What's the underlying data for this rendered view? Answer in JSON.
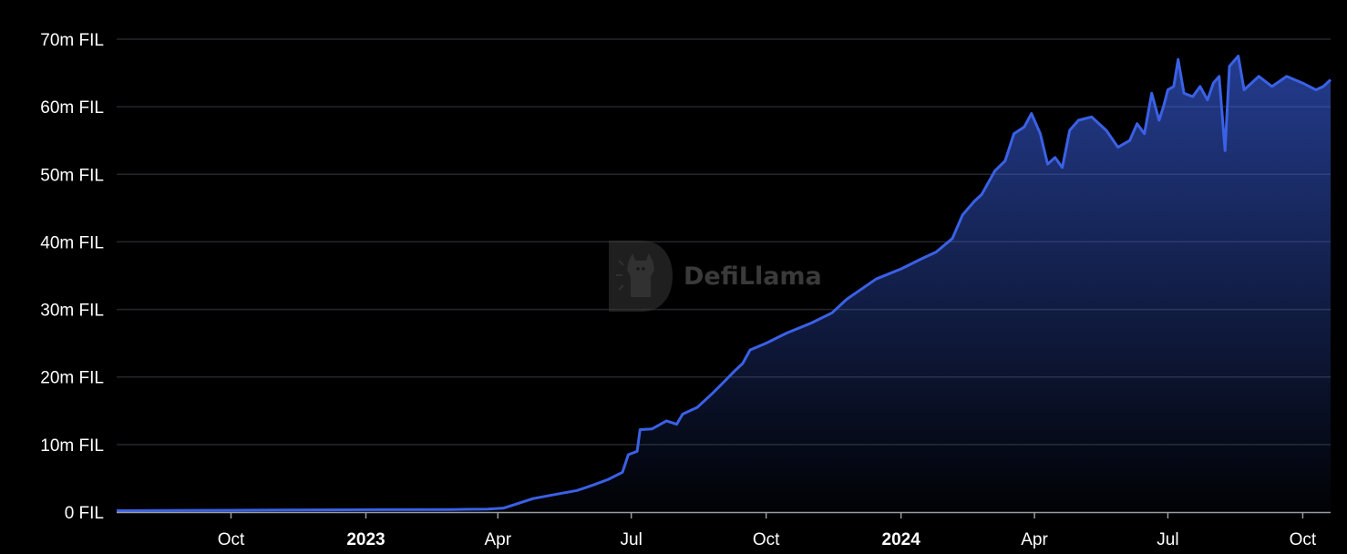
{
  "chart_data": {
    "type": "area",
    "title": "",
    "xlabel": "",
    "ylabel": "",
    "unit": "FIL",
    "ylim": [
      0,
      70000000
    ],
    "xlim": [
      "2022-07-15",
      "2024-10-20"
    ],
    "grid": true,
    "legend": "none",
    "y_ticks": [
      {
        "value": 0,
        "label": "0 FIL"
      },
      {
        "value": 10000000,
        "label": "10m FIL"
      },
      {
        "value": 20000000,
        "label": "20m FIL"
      },
      {
        "value": 30000000,
        "label": "30m FIL"
      },
      {
        "value": 40000000,
        "label": "40m FIL"
      },
      {
        "value": 50000000,
        "label": "50m FIL"
      },
      {
        "value": 60000000,
        "label": "60m FIL"
      },
      {
        "value": 70000000,
        "label": "70m FIL"
      }
    ],
    "x_ticks": [
      {
        "date": "2022-10-01",
        "label": "Oct",
        "bold": false
      },
      {
        "date": "2023-01-01",
        "label": "2023",
        "bold": true
      },
      {
        "date": "2023-04-01",
        "label": "Apr",
        "bold": false
      },
      {
        "date": "2023-07-01",
        "label": "Jul",
        "bold": false
      },
      {
        "date": "2023-10-01",
        "label": "Oct",
        "bold": false
      },
      {
        "date": "2024-01-01",
        "label": "2024",
        "bold": true
      },
      {
        "date": "2024-04-01",
        "label": "Apr",
        "bold": false
      },
      {
        "date": "2024-07-01",
        "label": "Jul",
        "bold": false
      },
      {
        "date": "2024-10-01",
        "label": "Oct",
        "bold": false
      }
    ],
    "series": [
      {
        "color": "#3a61e6",
        "points": [
          [
            "2022-07-15",
            200000
          ],
          [
            "2022-09-01",
            250000
          ],
          [
            "2022-11-01",
            300000
          ],
          [
            "2023-01-01",
            350000
          ],
          [
            "2023-03-01",
            380000
          ],
          [
            "2023-03-25",
            450000
          ],
          [
            "2023-04-05",
            600000
          ],
          [
            "2023-04-15",
            1300000
          ],
          [
            "2023-04-25",
            2000000
          ],
          [
            "2023-05-10",
            2600000
          ],
          [
            "2023-05-25",
            3200000
          ],
          [
            "2023-06-05",
            4000000
          ],
          [
            "2023-06-15",
            4800000
          ],
          [
            "2023-06-25",
            5900000
          ],
          [
            "2023-06-29",
            8500000
          ],
          [
            "2023-07-05",
            9000000
          ],
          [
            "2023-07-07",
            12200000
          ],
          [
            "2023-07-15",
            12300000
          ],
          [
            "2023-07-25",
            13500000
          ],
          [
            "2023-08-01",
            13000000
          ],
          [
            "2023-08-05",
            14500000
          ],
          [
            "2023-08-15",
            15500000
          ],
          [
            "2023-08-25",
            17500000
          ],
          [
            "2023-09-01",
            19000000
          ],
          [
            "2023-09-10",
            21000000
          ],
          [
            "2023-09-15",
            22000000
          ],
          [
            "2023-09-20",
            24000000
          ],
          [
            "2023-10-01",
            25000000
          ],
          [
            "2023-10-15",
            26500000
          ],
          [
            "2023-11-01",
            28000000
          ],
          [
            "2023-11-15",
            29500000
          ],
          [
            "2023-11-25",
            31500000
          ],
          [
            "2023-12-05",
            33000000
          ],
          [
            "2023-12-15",
            34500000
          ],
          [
            "2024-01-01",
            36000000
          ],
          [
            "2024-01-15",
            37500000
          ],
          [
            "2024-01-25",
            38500000
          ],
          [
            "2024-02-05",
            40500000
          ],
          [
            "2024-02-12",
            44000000
          ],
          [
            "2024-02-20",
            46000000
          ],
          [
            "2024-02-25",
            47000000
          ],
          [
            "2024-03-05",
            50500000
          ],
          [
            "2024-03-12",
            52000000
          ],
          [
            "2024-03-18",
            56000000
          ],
          [
            "2024-03-25",
            57000000
          ],
          [
            "2024-03-30",
            59000000
          ],
          [
            "2024-04-05",
            56000000
          ],
          [
            "2024-04-10",
            51500000
          ],
          [
            "2024-04-15",
            52500000
          ],
          [
            "2024-04-20",
            51000000
          ],
          [
            "2024-04-25",
            56500000
          ],
          [
            "2024-05-01",
            58000000
          ],
          [
            "2024-05-10",
            58500000
          ],
          [
            "2024-05-20",
            56500000
          ],
          [
            "2024-05-28",
            54000000
          ],
          [
            "2024-06-05",
            55000000
          ],
          [
            "2024-06-10",
            57500000
          ],
          [
            "2024-06-15",
            56000000
          ],
          [
            "2024-06-20",
            62000000
          ],
          [
            "2024-06-25",
            58000000
          ],
          [
            "2024-06-28",
            60000000
          ],
          [
            "2024-07-01",
            62500000
          ],
          [
            "2024-07-05",
            63000000
          ],
          [
            "2024-07-08",
            67000000
          ],
          [
            "2024-07-12",
            62000000
          ],
          [
            "2024-07-18",
            61500000
          ],
          [
            "2024-07-23",
            63000000
          ],
          [
            "2024-07-28",
            61000000
          ],
          [
            "2024-08-01",
            63500000
          ],
          [
            "2024-08-05",
            64500000
          ],
          [
            "2024-08-09",
            53500000
          ],
          [
            "2024-08-12",
            66000000
          ],
          [
            "2024-08-18",
            67500000
          ],
          [
            "2024-08-22",
            62500000
          ],
          [
            "2024-09-01",
            64500000
          ],
          [
            "2024-09-10",
            63000000
          ],
          [
            "2024-09-20",
            64500000
          ],
          [
            "2024-10-01",
            63500000
          ],
          [
            "2024-10-10",
            62500000
          ],
          [
            "2024-10-15",
            63000000
          ],
          [
            "2024-10-20",
            64000000
          ]
        ]
      }
    ]
  },
  "watermark": {
    "text": "DefiLlama",
    "icon": "llama-logo-icon"
  }
}
